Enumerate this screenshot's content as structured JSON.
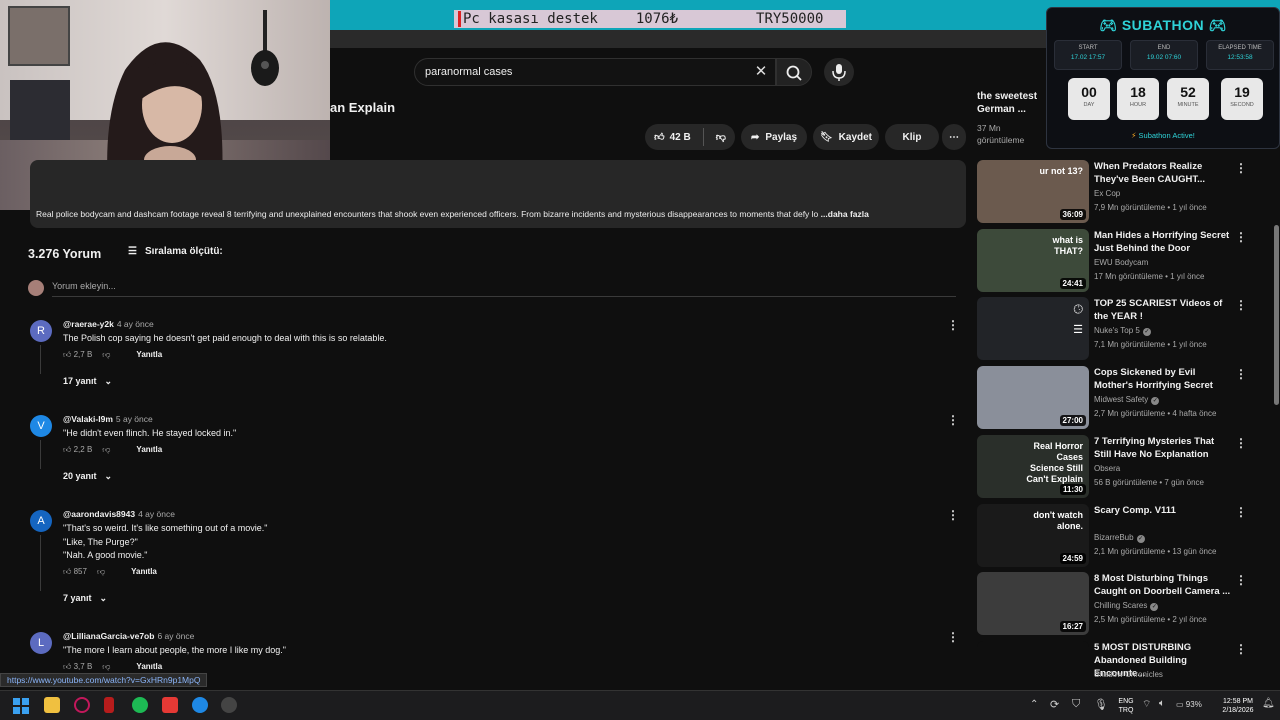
{
  "banner": {
    "donation_label": "Pc kasası destek",
    "donation_current": "1076₺",
    "donation_goal": "TRY50000"
  },
  "search": {
    "query": "paranormal cases"
  },
  "video": {
    "title_partial": "an Explain",
    "likes": "42 B",
    "share_label": "Paylaş",
    "save_label": "Kaydet",
    "clip_label": "Klip",
    "description": "Real police bodycam and dashcam footage reveal 8 terrifying and unexplained encounters that shook even experienced officers. From bizarre incidents and mysterious disappearances to moments that defy lo",
    "description_more": "...daha fazla"
  },
  "comments_header": {
    "count": "3.276 Yorum",
    "sort_label": "Sıralama ölçütü:",
    "add_placeholder": "Yorum ekleyin..."
  },
  "comments": [
    {
      "initial": "R",
      "avatar_color": "#5c6bc0",
      "author": "@raerae-y2k",
      "time": "4 ay önce",
      "text": "The Polish cop saying he doesn't get paid enough to deal with this is so relatable.",
      "likes": "2,7 B",
      "reply": "Yanıtla",
      "replies": "17 yanıt"
    },
    {
      "initial": "V",
      "avatar_color": "#1e88e5",
      "author": "@Valaki-I9m",
      "time": "5 ay önce",
      "text": "\"He didn't even flinch. He stayed locked in.\"",
      "likes": "2,2 B",
      "reply": "Yanıtla",
      "replies": "20 yanıt"
    },
    {
      "initial": "A",
      "avatar_color": "#1565c0",
      "author": "@aarondavis8943",
      "time": "4 ay önce",
      "text": "\"That's so weird. It's like something out of a movie.\"\n\"Like, The Purge?\"\n\"Nah. A good movie.\"",
      "likes": "857",
      "reply": "Yanıtla",
      "replies": "7 yanıt"
    },
    {
      "initial": "L",
      "avatar_color": "#5c6bc0",
      "author": "@LillianaGarcia-ve7ob",
      "time": "6 ay önce",
      "text": "\"The more I learn about people, the more I like my dog.\"",
      "likes": "3,7 B",
      "reply": "Yanıtla",
      "replies": ""
    }
  ],
  "status_url": "https://www.youtube.com/watch?v=GxHRn9p1MpQ",
  "previous_video": {
    "title": "the sweetest German ...",
    "views": "37 Mn görüntüleme"
  },
  "subathon": {
    "title": "SUBATHON",
    "start_label": "START",
    "start_value": "17.02 17:57",
    "end_label": "END",
    "end_value": "19.02 07:60",
    "elapsed_label": "ELAPSED TIME",
    "elapsed_value": "12:53:58",
    "counters": [
      {
        "value": "00",
        "unit": "DAY"
      },
      {
        "value": "18",
        "unit": "HOUR"
      },
      {
        "value": "52",
        "unit": "MINUTE"
      },
      {
        "value": "19",
        "unit": "SECOND"
      }
    ],
    "status": "Subathon Active!",
    "accent": "#2fd3d8"
  },
  "related": [
    {
      "title": "When Predators Realize They've Been CAUGHT...",
      "channel": "Ex Cop",
      "verified": false,
      "meta": "7,9 Mn görüntüleme • 1 yıl önce",
      "duration": "36:09",
      "thumb_text": "ur not 13?",
      "thumb_color": "#6b5a4e"
    },
    {
      "title": "Man Hides a Horrifying Secret Just Behind the Door",
      "channel": "EWU Bodycam",
      "verified": false,
      "meta": "17 Mn görüntüleme • 1 yıl önce",
      "duration": "24:41",
      "thumb_text": "what is THAT?",
      "thumb_color": "#3d4a3a"
    },
    {
      "title": "TOP 25 SCARIEST Videos of the YEAR !",
      "channel": "Nuke's Top 5",
      "verified": true,
      "meta": "7,1 Mn görüntüleme • 1 yıl önce",
      "duration": "",
      "thumb_text": "",
      "thumb_color": "#222428"
    },
    {
      "title": "Cops Sickened by Evil Mother's Horrifying Secret",
      "channel": "Midwest Safety",
      "verified": true,
      "meta": "2,7 Mn görüntüleme • 4 hafta önce",
      "duration": "27:00",
      "thumb_text": "",
      "thumb_color": "#8a8f9a"
    },
    {
      "title": "7 Terrifying Mysteries That Still Have No Explanation",
      "channel": "Obsera",
      "verified": false,
      "meta": "56 B görüntüleme • 7 gün önce",
      "duration": "11:30",
      "thumb_text": "Real Horror Cases Science Still Can't Explain",
      "thumb_color": "#2a2f2a"
    },
    {
      "title": "Scary Comp. V111",
      "channel": "BizarreBub",
      "verified": true,
      "meta": "2,1 Mn görüntüleme • 13 gün önce",
      "duration": "24:59",
      "thumb_text": "don't watch alone.",
      "thumb_color": "#1a1a1a"
    },
    {
      "title": "8 Most Disturbing Things Caught on Doorbell Camera ...",
      "channel": "Chilling Scares",
      "verified": true,
      "meta": "2,5 Mn görüntüleme • 2 yıl önce",
      "duration": "16:27",
      "thumb_text": "",
      "thumb_color": "#3c3c3c"
    },
    {
      "title": "5 MOST DISTURBING Abandoned Building Encounte...",
      "channel": "Shadow Chronicles",
      "verified": false,
      "meta": "",
      "duration": "",
      "thumb_text": "",
      "thumb_color": "#0f0f0f"
    }
  ],
  "taskbar": {
    "lang": "ENG",
    "lang2": "TRQ",
    "battery": "93%",
    "time": "12:58 PM",
    "date": "2/18/2026"
  }
}
